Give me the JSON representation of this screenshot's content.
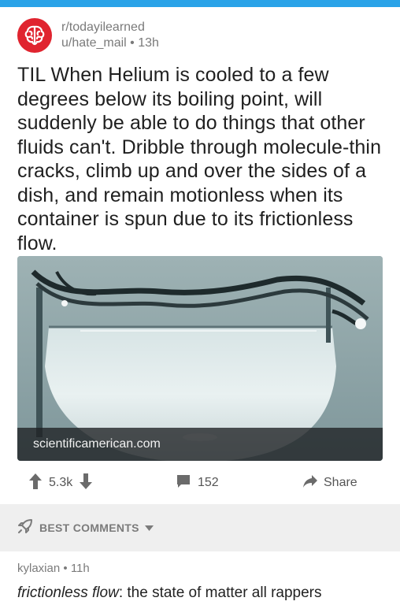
{
  "colors": {
    "top_bar": "#2aa3e8",
    "avatar_bg": "#e0242f",
    "muted_text": "#7a7a7a",
    "sort_bar_bg": "#efefef"
  },
  "post": {
    "subreddit": "r/todayilearned",
    "author": "u/hate_mail",
    "separator": "•",
    "age": "13h",
    "title": "TIL When Helium is cooled to a few degrees below its boiling point, will suddenly be able to do things that other fluids can't. Dribble through molecule-thin cracks, climb up and over the sides of a dish, and remain motionless when its container is spun due to its frictionless flow.",
    "link_domain": "scientificamerican.com",
    "avatar_icon": "brain-icon"
  },
  "actions": {
    "score": "5.3k",
    "comment_count": "152",
    "share_label": "Share",
    "icons": [
      "upvote-arrow-icon",
      "downvote-arrow-icon",
      "comment-bubble-icon",
      "share-arrow-icon"
    ]
  },
  "sort": {
    "label": "BEST COMMENTS",
    "icon": "rocket-icon"
  },
  "comment": {
    "author": "kylaxian",
    "separator": "•",
    "age": "11h",
    "body_emphasis": "frictionless flow",
    "body_rest": ": the state of matter all rappers"
  }
}
